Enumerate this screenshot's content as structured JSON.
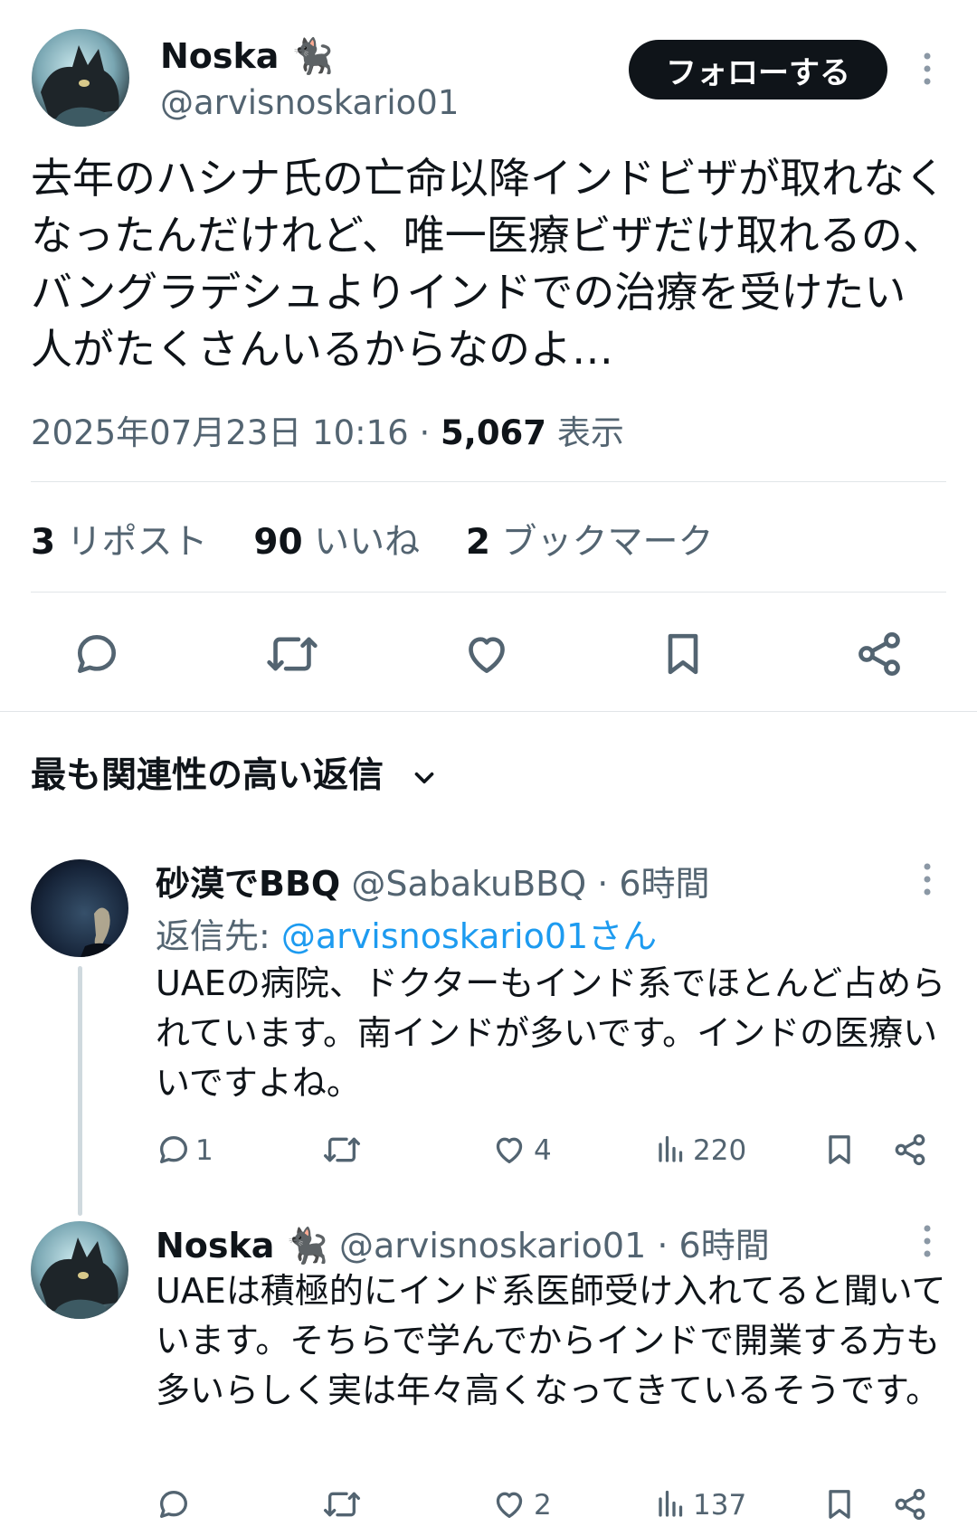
{
  "tweet": {
    "author": {
      "name": "Noska",
      "emoji": "🐈‍⬛",
      "handle": "@arvisnoskario01"
    },
    "follow_label": "フォローする",
    "text": "去年のハシナ氏の亡命以降インドビザが取れなくなったんだけれど、唯一医療ビザだけ取れるの、バングラデシュよりインドでの治療を受けたい人がたくさんいるからなのよ…",
    "timestamp": "2025年07月23日 10:16",
    "separator": "·",
    "views_count": "5,067",
    "views_label": "表示",
    "stats": [
      {
        "count": "3",
        "label": "リポスト"
      },
      {
        "count": "90",
        "label": "いいね"
      },
      {
        "count": "2",
        "label": "ブックマーク"
      }
    ],
    "actions": [
      "reply-icon",
      "retweet-icon",
      "like-icon",
      "bookmark-icon",
      "share-icon"
    ]
  },
  "replies_section": {
    "title": "最も関連性の高い返信"
  },
  "replies": [
    {
      "name": "砂漠でBBQ",
      "handle": "@SabakuBBQ",
      "time": "· 6時間",
      "reply_to_prefix": "返信先: ",
      "reply_to_handle": "@arvisnoskario01さん",
      "text": "UAEの病院、ドクターもインド系でほとんど占められています。南インドが多いです。インドの医療いいですよね。",
      "replies": "1",
      "retweets": "",
      "likes": "4",
      "views": "220"
    },
    {
      "name": "Noska",
      "emoji": "🐈‍⬛",
      "handle": "@arvisnoskario01",
      "time": "· 6時間",
      "text": "UAEは積極的にインド系医師受け入れてると聞いています。そちらで学んでからインドで開業する方も多いらしく実は年々高くなってきているそうです。",
      "replies": "",
      "retweets": "",
      "likes": "2",
      "views": "137"
    }
  ],
  "colors": {
    "text": "#0f1419",
    "muted": "#536471",
    "link": "#1d9bf0",
    "divider": "#e1e5e8",
    "button": "#0f1419"
  }
}
